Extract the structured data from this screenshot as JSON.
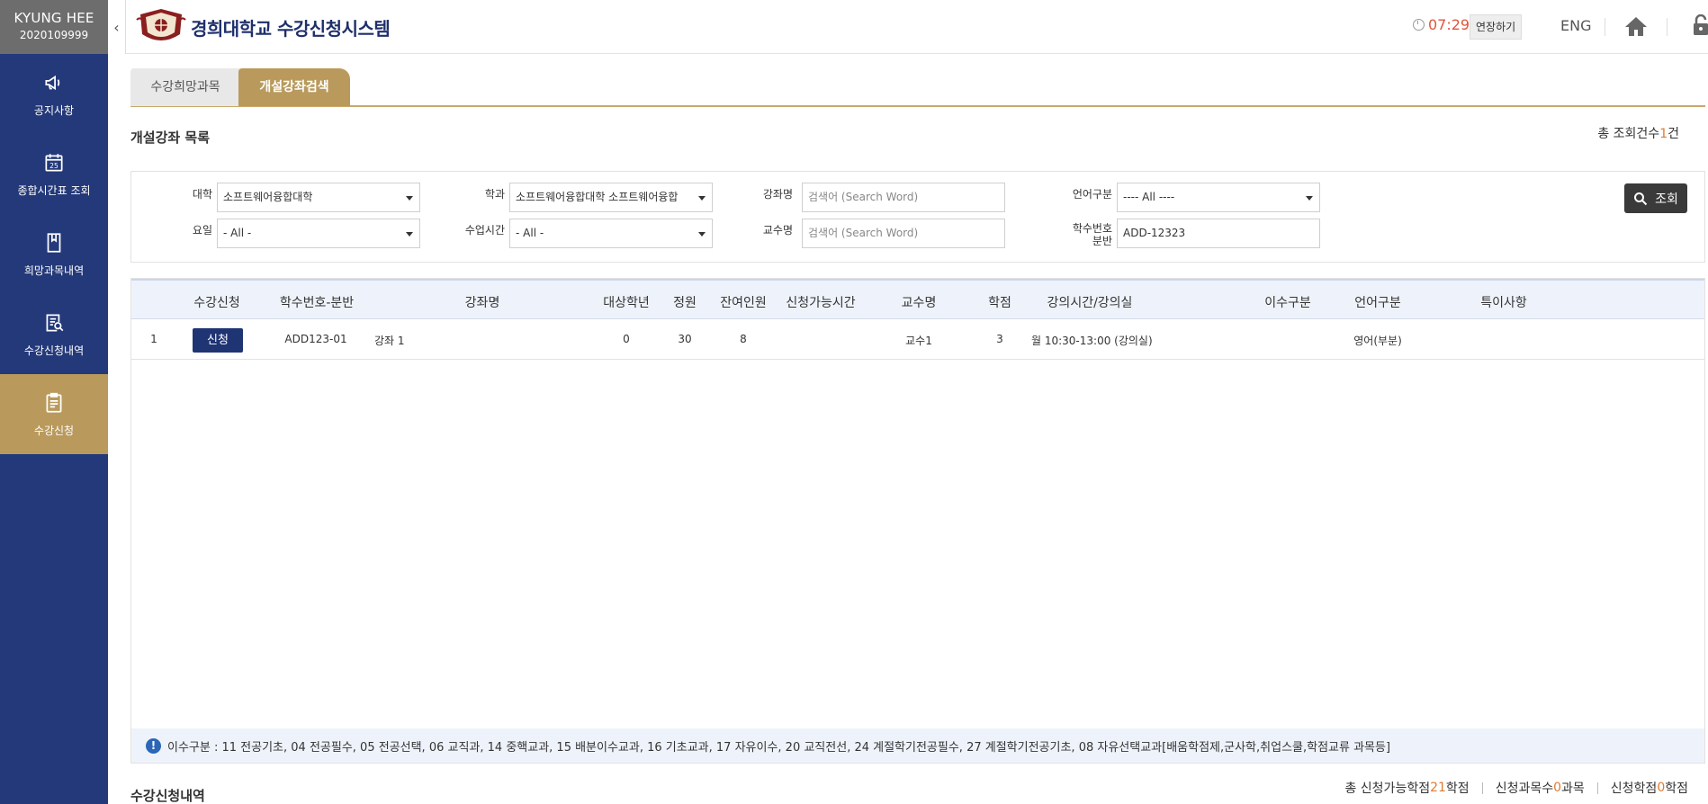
{
  "user": {
    "name": "KYUNG HEE",
    "id": "2020109999"
  },
  "sidebar": {
    "items": [
      {
        "label": "공지사항",
        "icon": "megaphone-icon"
      },
      {
        "label": "종합시간표 조회",
        "icon": "calendar-icon"
      },
      {
        "label": "희망과목내역",
        "icon": "bookmark-icon"
      },
      {
        "label": "수강신청내역",
        "icon": "document-search-icon"
      },
      {
        "label": "수강신청",
        "icon": "clipboard-icon",
        "active": true
      }
    ]
  },
  "header": {
    "title": "경희대학교 수강신청시스템",
    "timer": "07:29",
    "extend_label": "연장하기",
    "lang_label": "ENG"
  },
  "tabs": [
    {
      "label": "수강희망과목"
    },
    {
      "label": "개설강좌검색",
      "active": true
    }
  ],
  "section": {
    "title": "개설강좌 목록",
    "total_prefix": "총 조회건수",
    "total_count": "1",
    "total_suffix": "건"
  },
  "filters": {
    "college_label": "대학",
    "college_value": "소프트웨어융합대학",
    "dept_label": "학과",
    "dept_value": "소프트웨어융합대학 소프트웨어융합",
    "course_label": "강좌명",
    "course_placeholder": "검색어 (Search Word)",
    "lang_label": "언어구분",
    "lang_value": "---- All ----",
    "day_label": "요일",
    "day_value": "- All -",
    "time_label": "수업시간",
    "time_value": "- All -",
    "prof_label": "교수명",
    "prof_placeholder": "검색어 (Search Word)",
    "code_label_1": "학수번호",
    "code_label_2": "분반",
    "code_value": "ADD-12323",
    "search_label": "조회"
  },
  "table": {
    "headers": [
      "수강신청",
      "학수번호-분반",
      "강좌명",
      "대상학년",
      "정원",
      "잔여인원",
      "신청가능시간",
      "교수명",
      "학점",
      "강의시간/강의실",
      "이수구분",
      "언어구분",
      "특이사항"
    ],
    "rows": [
      {
        "no": "1",
        "apply_label": "신청",
        "code": "ADD123-01",
        "name": "강좌 1",
        "grade": "0",
        "capacity": "30",
        "remaining": "8",
        "available_time": "",
        "professor": "교수1",
        "credit": "3",
        "schedule": "월 10:30-13:00 (강의실)",
        "category": "",
        "language": "영어(부분)",
        "note": ""
      }
    ]
  },
  "info": {
    "text": "이수구분 : 11 전공기초, 04 전공필수, 05 전공선택, 06 교직과, 14 중핵교과, 15 배분이수교과, 16 기초교과, 17 자유이수, 20 교직전선, 24 계절학기전공필수, 27 계절학기전공기초, 08 자유선택교과[배움학점제,군사학,취업스쿨,학점교류 과목등]"
  },
  "bottom": {
    "title": "수강신청내역",
    "avail_prefix": "총 신청가능학점 ",
    "avail_value": "21",
    "avail_suffix": "학점",
    "subjects_prefix": "신청과목수",
    "subjects_value": "0",
    "subjects_suffix": "과목",
    "credits_prefix": "신청학점",
    "credits_value": "0",
    "credits_suffix": "학점"
  },
  "colors": {
    "sidebar": "#24397a",
    "accent_gold": "#b99a5c",
    "primary_button": "#1f3473",
    "highlight": "#e07a30"
  }
}
